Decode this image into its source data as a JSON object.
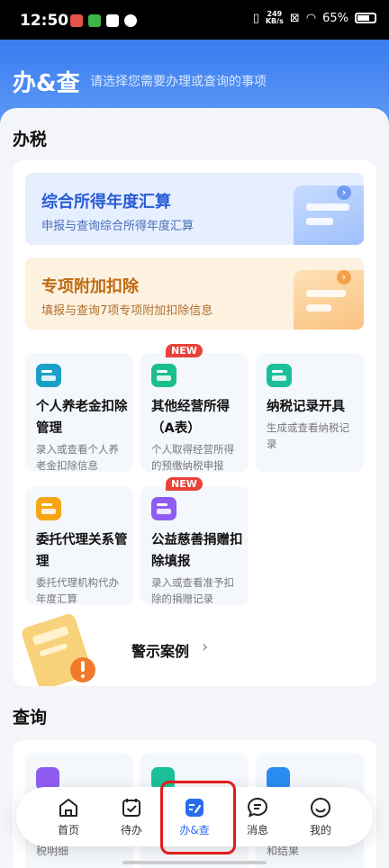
{
  "status_bar": {
    "time": "12:50",
    "net_speed_value": "249",
    "net_speed_unit": "KB/s",
    "battery": "65%"
  },
  "header": {
    "title": "办&查",
    "subtitle": "请选择您需要办理或查询的事项"
  },
  "tax_section": {
    "title": "办税",
    "banners": [
      {
        "title": "综合所得年度汇算",
        "subtitle": "申报与查询综合所得年度汇算",
        "color": "#2a5cd4"
      },
      {
        "title": "专项附加扣除",
        "subtitle": "填报与查询7项专项附加扣除信息",
        "color": "#c06a10"
      }
    ],
    "cards": [
      {
        "title": "个人养老金扣除管理",
        "desc": "录入或查看个人养老金扣除信息",
        "badge": "",
        "icon": "pension-icon",
        "color": "#1aa0c8"
      },
      {
        "title": "其他经营所得（A表）",
        "desc": "个人取得经营所得的预缴纳税申报",
        "badge": "NEW",
        "icon": "business-income-icon",
        "color": "#1bbf8c"
      },
      {
        "title": "纳税记录开具",
        "desc": "生成或查看纳税记录",
        "badge": "",
        "icon": "tax-record-icon",
        "color": "#1bbf9a"
      },
      {
        "title": "委托代理关系管理",
        "desc": "委托代理机构代办年度汇算",
        "badge": "",
        "icon": "agent-icon",
        "color": "#f5a614"
      },
      {
        "title": "公益慈善捐赠扣除填报",
        "desc": "录入或查看准予扣除的捐赠记录",
        "badge": "NEW",
        "icon": "donation-icon",
        "color": "#8e5cf0"
      }
    ],
    "warning_label": "警示案例"
  },
  "query_section": {
    "title": "查询",
    "cards": [
      {
        "partial_text": "税明细",
        "icon": "tax-detail-icon",
        "color": "#8e5cf0"
      },
      {
        "partial_text": "",
        "icon": "query-icon",
        "color": "#1bbf9a"
      },
      {
        "partial_text": "和结果",
        "icon": "result-icon",
        "color": "#2a8cf0"
      }
    ]
  },
  "bottom_nav": {
    "items": [
      {
        "label": "首页",
        "icon": "home-icon"
      },
      {
        "label": "待办",
        "icon": "todo-icon"
      },
      {
        "label": "办&查",
        "icon": "handle-query-icon",
        "active": true
      },
      {
        "label": "消息",
        "icon": "message-icon"
      },
      {
        "label": "我的",
        "icon": "profile-icon"
      }
    ],
    "active_color": "#2a6cf0"
  }
}
